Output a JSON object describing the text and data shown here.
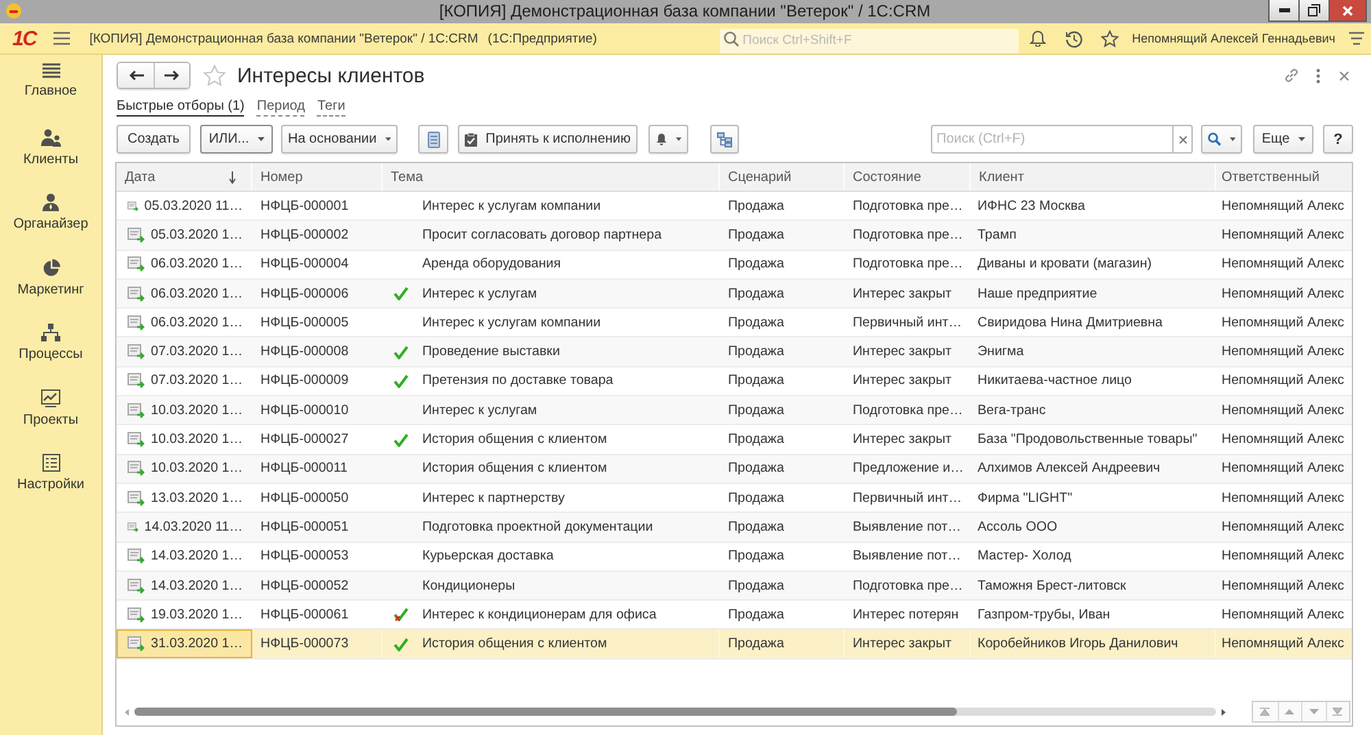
{
  "window": {
    "title": "[КОПИЯ] Демонстрационная база компании \"Ветерок\" / 1C:CRM"
  },
  "app_bar": {
    "logo": "1С",
    "title": "[КОПИЯ] Демонстрационная база компании \"Ветерок\" / 1C:CRM",
    "product": "(1С:Предприятие)",
    "search": {
      "placeholder": "Поиск Ctrl+Shift+F"
    },
    "user": "Непомнящий Алексей Геннадьевич"
  },
  "sidebar": {
    "items": [
      {
        "label": "Главное"
      },
      {
        "label": "Клиенты"
      },
      {
        "label": "Органайзер"
      },
      {
        "label": "Маркетинг"
      },
      {
        "label": "Процессы"
      },
      {
        "label": "Проекты"
      },
      {
        "label": "Настройки"
      }
    ]
  },
  "form": {
    "title": "Интересы клиентов",
    "filters": [
      {
        "label": "Быстрые отборы (1)",
        "active": true
      },
      {
        "label": "Период",
        "active": false
      },
      {
        "label": "Теги",
        "active": false
      }
    ],
    "toolbar": {
      "create": "Создать",
      "or": "ИЛИ...",
      "based_on": "На основании",
      "accept": "Принять к исполнению",
      "search": {
        "placeholder": "Поиск (Ctrl+F)"
      },
      "more": "Еще",
      "help": "?"
    },
    "table": {
      "columns": [
        {
          "label": "Дата",
          "sorted": true
        },
        {
          "label": "Номер",
          "sorted": false
        },
        {
          "label": "Тема",
          "sorted": false
        },
        {
          "label": "Сценарий",
          "sorted": false
        },
        {
          "label": "Состояние",
          "sorted": false
        },
        {
          "label": "Клиент",
          "sorted": false
        },
        {
          "label": "Ответственный",
          "sorted": false
        }
      ],
      "rows": [
        {
          "date": "05.03.2020 11…",
          "number": "НФЦБ-000001",
          "completed": false,
          "lost": false,
          "topic": "Интерес к услугам компании",
          "scenario": "Продажа",
          "state": "Подготовка пре…",
          "client": "ИФНС 23 Москва",
          "responsible": "Непомнящий Алекс",
          "selected": false
        },
        {
          "date": "05.03.2020 1…",
          "number": "НФЦБ-000002",
          "completed": false,
          "lost": false,
          "topic": "Просит согласовать договор партнера",
          "scenario": "Продажа",
          "state": "Подготовка пре…",
          "client": "Трамп",
          "responsible": "Непомнящий Алекс",
          "selected": false
        },
        {
          "date": "06.03.2020 1…",
          "number": "НФЦБ-000004",
          "completed": false,
          "lost": false,
          "topic": "Аренда оборудования",
          "scenario": "Продажа",
          "state": "Подготовка пре…",
          "client": "Диваны и кровати (магазин)",
          "responsible": "Непомнящий Алекс",
          "selected": false
        },
        {
          "date": "06.03.2020 1…",
          "number": "НФЦБ-000006",
          "completed": true,
          "lost": false,
          "topic": "Интерес к услугам",
          "scenario": "Продажа",
          "state": "Интерес закрыт",
          "client": "Наше предприятие",
          "responsible": "Непомнящий Алекс",
          "selected": false
        },
        {
          "date": "06.03.2020 1…",
          "number": "НФЦБ-000005",
          "completed": false,
          "lost": false,
          "topic": "Интерес к услугам компании",
          "scenario": "Продажа",
          "state": "Первичный инт…",
          "client": "Свиридова Нина Дмитриевна",
          "responsible": "Непомнящий Алекс",
          "selected": false
        },
        {
          "date": "07.03.2020 1…",
          "number": "НФЦБ-000008",
          "completed": true,
          "lost": false,
          "topic": "Проведение выставки",
          "scenario": "Продажа",
          "state": "Интерес закрыт",
          "client": "Энигма",
          "responsible": "Непомнящий Алекс",
          "selected": false
        },
        {
          "date": "07.03.2020 1…",
          "number": "НФЦБ-000009",
          "completed": true,
          "lost": false,
          "topic": "Претензия по доставке товара",
          "scenario": "Продажа",
          "state": "Интерес закрыт",
          "client": "Никитаева-частное лицо",
          "responsible": "Непомнящий Алекс",
          "selected": false
        },
        {
          "date": "10.03.2020 1…",
          "number": "НФЦБ-000010",
          "completed": false,
          "lost": false,
          "topic": "Интерес к услугам",
          "scenario": "Продажа",
          "state": "Подготовка пре…",
          "client": "Вега-транс",
          "responsible": "Непомнящий Алекс",
          "selected": false
        },
        {
          "date": "10.03.2020 1…",
          "number": "НФЦБ-000027",
          "completed": true,
          "lost": false,
          "topic": "История общения с клиентом",
          "scenario": "Продажа",
          "state": "Интерес закрыт",
          "client": "База \"Продовольственные товары\"",
          "responsible": "Непомнящий Алекс",
          "selected": false
        },
        {
          "date": "10.03.2020 1…",
          "number": "НФЦБ-000011",
          "completed": false,
          "lost": false,
          "topic": "История общения с клиентом",
          "scenario": "Продажа",
          "state": "Предложение и…",
          "client": "Алхимов Алексей Андреевич",
          "responsible": "Непомнящий Алекс",
          "selected": false
        },
        {
          "date": "13.03.2020 1…",
          "number": "НФЦБ-000050",
          "completed": false,
          "lost": false,
          "topic": "Интерес к партнерству",
          "scenario": "Продажа",
          "state": "Первичный инт…",
          "client": "Фирма \"LIGHT\"",
          "responsible": "Непомнящий Алекс",
          "selected": false
        },
        {
          "date": "14.03.2020 11…",
          "number": "НФЦБ-000051",
          "completed": false,
          "lost": false,
          "topic": "Подготовка проектной документации",
          "scenario": "Продажа",
          "state": "Выявление пот…",
          "client": "Ассоль ООО",
          "responsible": "Непомнящий Алекс",
          "selected": false
        },
        {
          "date": "14.03.2020 1…",
          "number": "НФЦБ-000053",
          "completed": false,
          "lost": false,
          "topic": "Курьерская доставка",
          "scenario": "Продажа",
          "state": "Выявление пот…",
          "client": "Мастер- Холод",
          "responsible": "Непомнящий Алекс",
          "selected": false
        },
        {
          "date": "14.03.2020 1…",
          "number": "НФЦБ-000052",
          "completed": false,
          "lost": false,
          "topic": "Кондиционеры",
          "scenario": "Продажа",
          "state": "Подготовка пре…",
          "client": "Таможня Брест-литовск",
          "responsible": "Непомнящий Алекс",
          "selected": false
        },
        {
          "date": "19.03.2020 1…",
          "number": "НФЦБ-000061",
          "completed": true,
          "lost": true,
          "topic": "Интерес к кондиционерам для офиса",
          "scenario": "Продажа",
          "state": "Интерес потерян",
          "client": "Газпром-трубы, Иван",
          "responsible": "Непомнящий Алекс",
          "selected": false
        },
        {
          "date": "31.03.2020 1…",
          "number": "НФЦБ-000073",
          "completed": true,
          "lost": false,
          "topic": "История общения с клиентом",
          "scenario": "Продажа",
          "state": "Интерес закрыт",
          "client": "Коробейников Игорь Данилович",
          "responsible": "Непомнящий Алекс",
          "selected": true
        }
      ]
    }
  }
}
